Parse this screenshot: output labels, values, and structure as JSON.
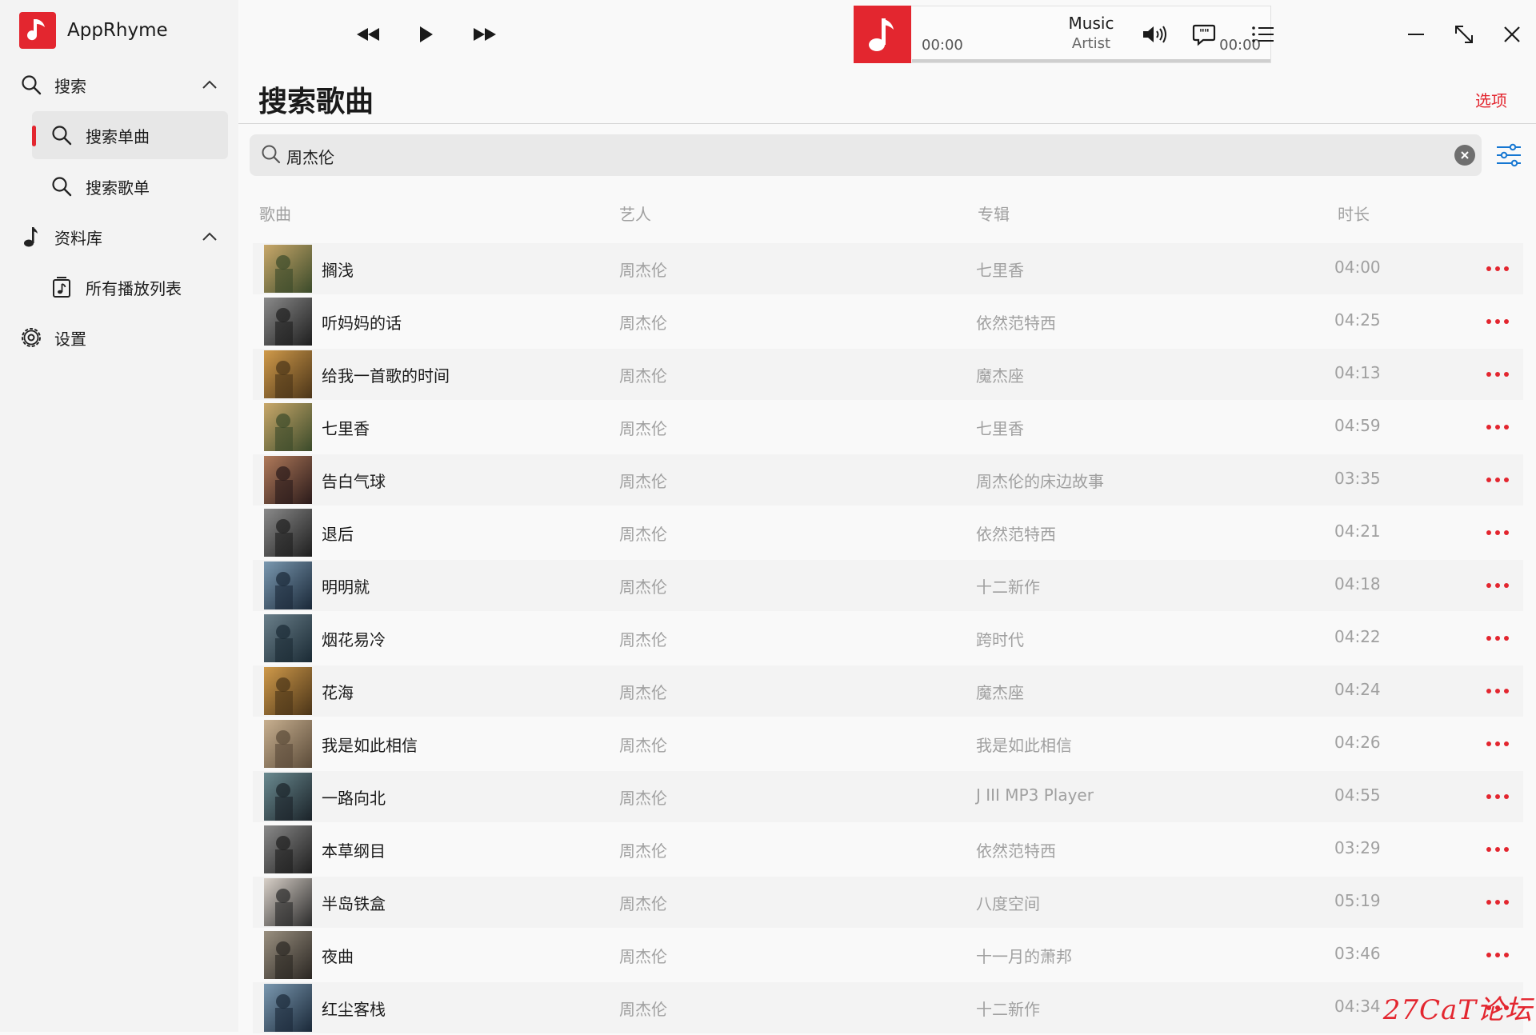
{
  "app": {
    "name": "AppRhyme"
  },
  "sidebar": {
    "items": [
      {
        "label": "搜索",
        "icon": "search-icon"
      },
      {
        "label": "搜索单曲",
        "icon": "search-icon"
      },
      {
        "label": "搜索歌单",
        "icon": "search-icon"
      },
      {
        "label": "资料库",
        "icon": "music-note-icon"
      },
      {
        "label": "所有播放列表",
        "icon": "playlist-icon"
      },
      {
        "label": "设置",
        "icon": "gear-icon"
      }
    ]
  },
  "player": {
    "title": "Music",
    "artist": "Artist",
    "current_time": "00:00",
    "total_time": "00:00",
    "progress": 0
  },
  "page": {
    "title": "搜索歌曲",
    "options_label": "选项"
  },
  "search": {
    "value": "周杰伦"
  },
  "table": {
    "columns": [
      "歌曲",
      "艺人",
      "专辑",
      "时长"
    ],
    "rows": [
      {
        "title": "搁浅",
        "artist": "周杰伦",
        "album": "七里香",
        "duration": "04:00"
      },
      {
        "title": "听妈妈的话",
        "artist": "周杰伦",
        "album": "依然范特西",
        "duration": "04:25"
      },
      {
        "title": "给我一首歌的时间",
        "artist": "周杰伦",
        "album": "魔杰座",
        "duration": "04:13"
      },
      {
        "title": "七里香",
        "artist": "周杰伦",
        "album": "七里香",
        "duration": "04:59"
      },
      {
        "title": "告白气球",
        "artist": "周杰伦",
        "album": "周杰伦的床边故事",
        "duration": "03:35"
      },
      {
        "title": "退后",
        "artist": "周杰伦",
        "album": "依然范特西",
        "duration": "04:21"
      },
      {
        "title": "明明就",
        "artist": "周杰伦",
        "album": "十二新作",
        "duration": "04:18"
      },
      {
        "title": "烟花易冷",
        "artist": "周杰伦",
        "album": "跨时代",
        "duration": "04:22"
      },
      {
        "title": "花海",
        "artist": "周杰伦",
        "album": "魔杰座",
        "duration": "04:24"
      },
      {
        "title": "我是如此相信",
        "artist": "周杰伦",
        "album": "我是如此相信",
        "duration": "04:26"
      },
      {
        "title": "一路向北",
        "artist": "周杰伦",
        "album": "J III MP3 Player",
        "duration": "04:55"
      },
      {
        "title": "本草纲目",
        "artist": "周杰伦",
        "album": "依然范特西",
        "duration": "03:29"
      },
      {
        "title": "半岛铁盒",
        "artist": "周杰伦",
        "album": "八度空间",
        "duration": "05:19"
      },
      {
        "title": "夜曲",
        "artist": "周杰伦",
        "album": "十一月的萧邦",
        "duration": "03:46"
      },
      {
        "title": "红尘客栈",
        "artist": "周杰伦",
        "album": "十二新作",
        "duration": "04:34"
      }
    ]
  },
  "watermark": "27CaT论坛",
  "colors": {
    "accent": "#e3262f",
    "filter": "#1677d2"
  }
}
